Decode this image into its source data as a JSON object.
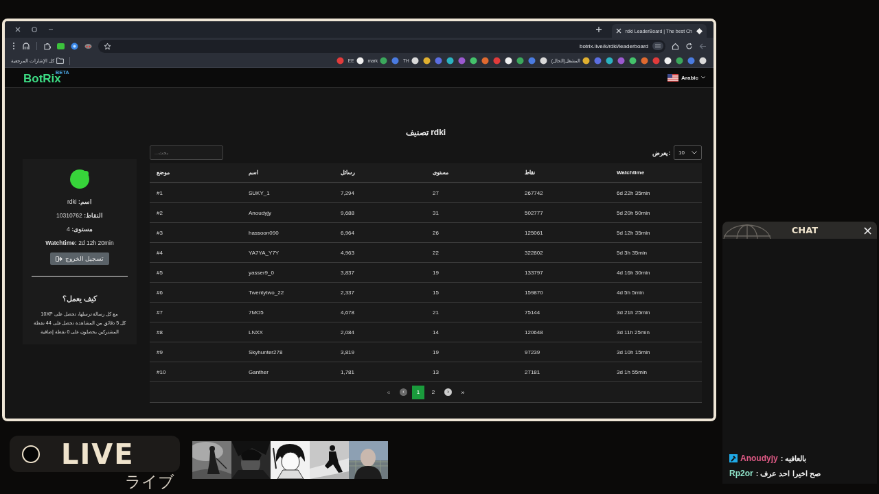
{
  "browser": {
    "tab_title": "rdki LeaderBoard | The best Ch",
    "url": "botrix.live/k/rdki/leaderboard",
    "all_bookmarks": "كل الإشارات المرجعية",
    "bookmarks": [
      {
        "label": "EE"
      },
      {
        "label": "mark"
      },
      {
        "label": "TH"
      },
      {
        "label": "المشغل(الحال)"
      }
    ]
  },
  "navbar": {
    "logo": "BotRix",
    "badge": "BETA",
    "language": "Arabic"
  },
  "profile": {
    "fields": [
      {
        "label": "اسم:",
        "value": "rdki"
      },
      {
        "label": "النقاط:",
        "value": "10310762"
      },
      {
        "label": "مستوى:",
        "value": "4"
      },
      {
        "label": "Watchtime:",
        "value": "2d 12h 20min"
      }
    ],
    "logout": "تسجيل الخروج",
    "how_it_works": {
      "title": "كيف يعمل؟",
      "lines": [
        "مع كل رسالة ترسلها، تحصل على 10XP",
        "كل 5 دقائق من المشاهدة تحصل على 44 نقطة",
        "المشتركين يحصلون على 0 نقطة إضافية"
      ]
    }
  },
  "leaderboard": {
    "title": "تصنيف rdki",
    "search_placeholder": "بحث...",
    "page_size_label": "يعرض:",
    "page_size": "10",
    "columns": [
      "موضع",
      "اسم",
      "رسائل",
      "مستوى",
      "نقاط",
      "Watchtime"
    ],
    "rows": [
      [
        "#1",
        "SUKY_1",
        "7,294",
        "27",
        "267742",
        "6d 22h 35min"
      ],
      [
        "#2",
        "Anoudyjy",
        "9,688",
        "31",
        "502777",
        "5d 20h 50min"
      ],
      [
        "#3",
        "hassoon090",
        "6,964",
        "26",
        "125061",
        "5d 12h 35min"
      ],
      [
        "#4",
        "YA7YA_Y7Y",
        "4,963",
        "22",
        "322802",
        "5d 3h 35min"
      ],
      [
        "#5",
        "yasser9_0",
        "3,837",
        "19",
        "133797",
        "4d 16h 30min"
      ],
      [
        "#6",
        "Twentytwo_22",
        "2,337",
        "15",
        "159870",
        "4d 5h 5min"
      ],
      [
        "#7",
        "7MO5",
        "4,678",
        "21",
        "75144",
        "3d 21h 25min"
      ],
      [
        "#8",
        "LNXX",
        "2,084",
        "14",
        "120648",
        "3d 11h 25min"
      ],
      [
        "#9",
        "Skyhunter278",
        "3,819",
        "19",
        "97239",
        "3d 10h 15min"
      ],
      [
        "#10",
        "Ganther",
        "1,781",
        "13",
        "27181",
        "3d 1h 55min"
      ]
    ],
    "pagination": [
      {
        "kind": "first",
        "label": "«",
        "disabled": true,
        "selected": false
      },
      {
        "kind": "prev",
        "label": "‹",
        "disabled": true,
        "selected": false
      },
      {
        "kind": "page",
        "label": "1",
        "disabled": false,
        "selected": true
      },
      {
        "kind": "page",
        "label": "2",
        "disabled": false,
        "selected": false
      },
      {
        "kind": "next",
        "label": "›",
        "disabled": false,
        "selected": false
      },
      {
        "kind": "last",
        "label": "»",
        "disabled": false,
        "selected": false
      }
    ]
  },
  "live": {
    "label": "LIVE",
    "subtitle": "ライブ"
  },
  "chat": {
    "title": "CHAT",
    "close": "×",
    "messages": [
      {
        "user": "Anoudyjy",
        "color": "#e05a86",
        "moderator": true,
        "text": ": بالعافيه"
      },
      {
        "user": "Rp2or",
        "color": "#8fe3c9",
        "moderator": false,
        "text": ": صح اخيرا احد عرف"
      }
    ]
  }
}
